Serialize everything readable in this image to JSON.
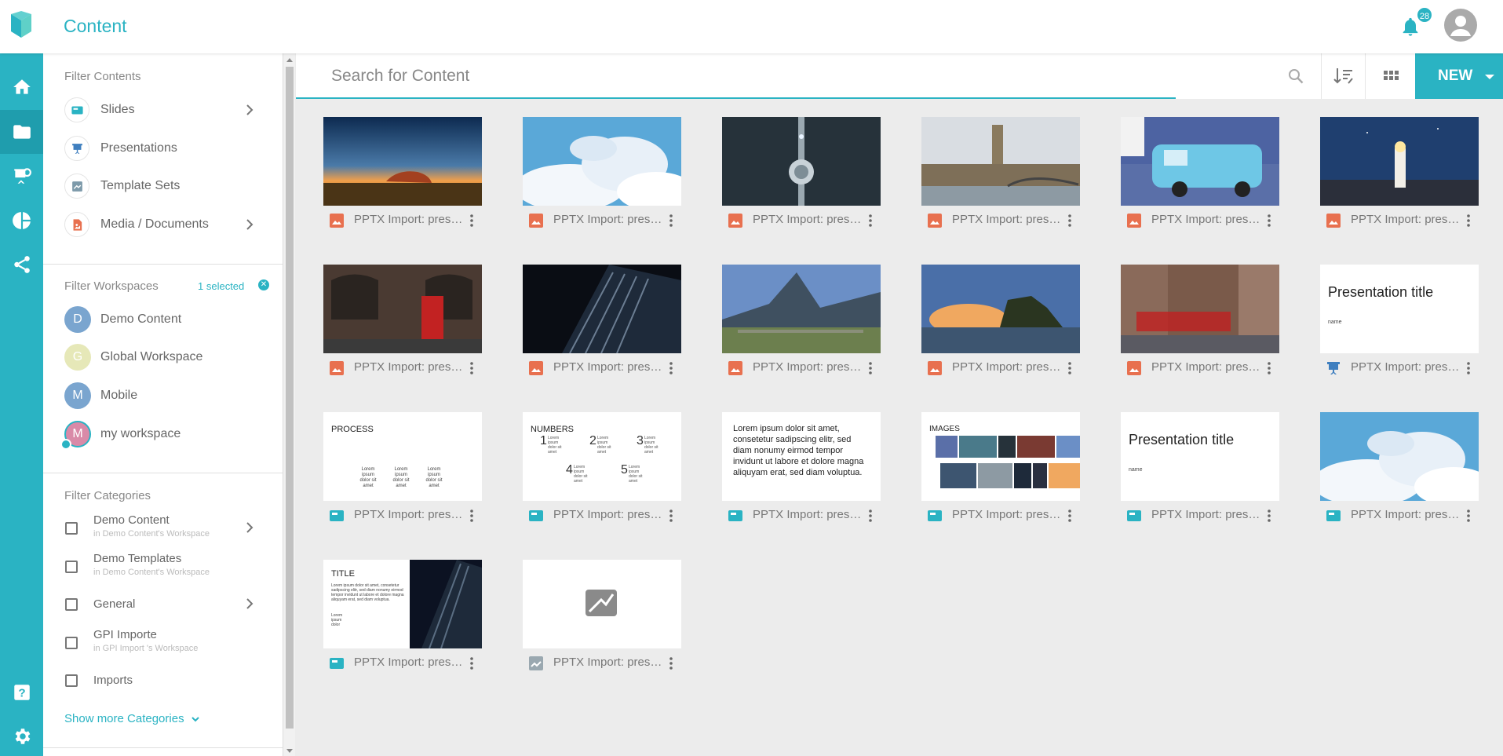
{
  "app": {
    "title": "Content",
    "notifications": "28"
  },
  "rail": {
    "items": [
      {
        "name": "home-icon"
      },
      {
        "name": "folder-icon",
        "active": true
      },
      {
        "name": "presentation-icon"
      },
      {
        "name": "pie-chart-icon"
      },
      {
        "name": "share-icon"
      },
      {
        "name": "help-icon"
      },
      {
        "name": "gear-icon"
      }
    ]
  },
  "filters": {
    "contents_title": "Filter Contents",
    "contents": [
      {
        "label": "Slides",
        "has_children": true
      },
      {
        "label": "Presentations",
        "has_children": false
      },
      {
        "label": "Template Sets",
        "has_children": false
      },
      {
        "label": "Media / Documents",
        "has_children": true
      }
    ],
    "workspaces_title": "Filter Workspaces",
    "selected_text": "1 selected",
    "workspaces": [
      {
        "initial": "D",
        "label": "Demo Content",
        "color": "#7aa5cf"
      },
      {
        "initial": "G",
        "label": "Global Workspace",
        "color": "#e6e8b8"
      },
      {
        "initial": "M",
        "label": "Mobile",
        "color": "#7aa5cf"
      },
      {
        "initial": "M",
        "label": "my workspace",
        "color": "#d98aa8",
        "selected": true
      }
    ],
    "categories_title": "Filter Categories",
    "categories": [
      {
        "label": "Demo Content",
        "sub": "in Demo Content's Workspace",
        "has_children": true
      },
      {
        "label": "Demo Templates",
        "sub": "in Demo Content's Workspace",
        "has_children": false
      },
      {
        "label": "General",
        "sub": "",
        "has_children": true
      },
      {
        "label": "GPI Importe",
        "sub": "in GPI Import 's Workspace",
        "has_children": false
      },
      {
        "label": "Imports",
        "sub": "",
        "has_children": false
      }
    ],
    "show_more": "Show more Categories"
  },
  "search": {
    "placeholder": "Search for Content",
    "value": ""
  },
  "toolbar": {
    "new_label": "NEW"
  },
  "colors": {
    "accent": "#2ab3c3",
    "image_icon": "#e8704f",
    "presentation_icon": "#3f7fbf"
  },
  "grid": {
    "items": [
      {
        "title": "PPTX Import: presentation",
        "type": "image",
        "thumb": "outback"
      },
      {
        "title": "PPTX Import: presentation",
        "type": "image",
        "thumb": "clouds"
      },
      {
        "title": "PPTX Import: presentation",
        "type": "image",
        "thumb": "tower"
      },
      {
        "title": "PPTX Import: presentation",
        "type": "image",
        "thumb": "london"
      },
      {
        "title": "PPTX Import: presentation",
        "type": "image",
        "thumb": "van"
      },
      {
        "title": "PPTX Import: presentation",
        "type": "image",
        "thumb": "lighthouse"
      },
      {
        "title": "PPTX Import: presentation",
        "type": "image",
        "thumb": "phonebox"
      },
      {
        "title": "PPTX Import: presentation",
        "type": "image",
        "thumb": "skyscraper"
      },
      {
        "title": "PPTX Import: presentation",
        "type": "image",
        "thumb": "machu"
      },
      {
        "title": "PPTX Import: presentation",
        "type": "image",
        "thumb": "temple"
      },
      {
        "title": "PPTX Import: presentation",
        "type": "image",
        "thumb": "street"
      },
      {
        "title": "PPTX Import: presentation",
        "type": "presentation",
        "thumb": "pres-title",
        "slide_title": "Presentation title",
        "slide_sub": "name"
      },
      {
        "title": "PPTX Import: presentation",
        "type": "slide",
        "thumb": "process",
        "slide_title": "PROCESS",
        "slide_body": "Lorem ipsum dolor sit amet"
      },
      {
        "title": "PPTX Import: presentation",
        "type": "slide",
        "thumb": "numbers",
        "slide_title": "NUMBERS",
        "slide_numbers": [
          "1",
          "2",
          "3",
          "4",
          "5"
        ],
        "slide_body": "Lorem ipsum dolor sit amet"
      },
      {
        "title": "PPTX Import: presentation",
        "type": "slide",
        "thumb": "lorem",
        "slide_text": "Lorem ipsum dolor sit amet, consetetur sadipscing elitr, sed diam nonumy eirmod tempor invidunt ut labore et dolore magna aliquyam erat, sed diam voluptua."
      },
      {
        "title": "PPTX Import: presentation",
        "type": "slide",
        "thumb": "images",
        "slide_title": "IMAGES"
      },
      {
        "title": "PPTX Import: presentation",
        "type": "slide",
        "thumb": "pres-title",
        "slide_title": "Presentation title",
        "slide_sub": "name"
      },
      {
        "title": "PPTX Import: presentation",
        "type": "slide",
        "thumb": "clouds"
      },
      {
        "title": "PPTX Import: presentation",
        "type": "slide",
        "thumb": "title-dark",
        "slide_title": "TITLE",
        "slide_body": "Lorem ipsum dolor sit amet, consetetur sadipscing elitr, sed diam nonumy eirmod tempor invidunt ut labore et dolore magna aliquyam erat, sed diam voluptua.",
        "slide_body2": "Lorem ipsum dolor"
      },
      {
        "title": "PPTX Import: presentation",
        "type": "template",
        "thumb": "template-placeholder"
      }
    ]
  }
}
